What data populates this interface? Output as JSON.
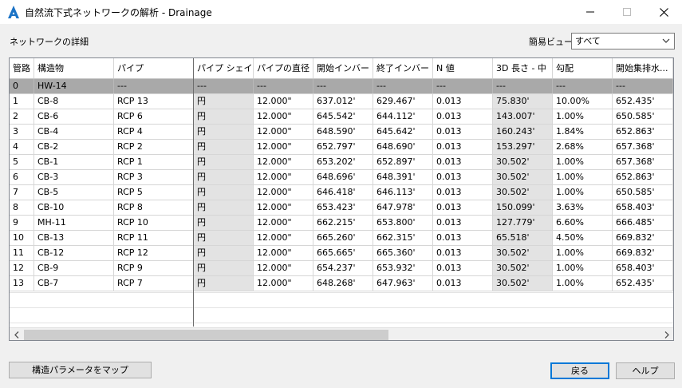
{
  "window": {
    "title": "自然流下式ネットワークの解析 - Drainage",
    "icon": "autodesk-a-icon",
    "controls": [
      "minimize-icon",
      "maximize-icon",
      "close-icon"
    ]
  },
  "header": {
    "network_label": "ネットワークの詳細",
    "view_label": "簡易ビュー",
    "view_value": "すべて"
  },
  "table": {
    "columns": [
      "管路",
      "構造物",
      "パイプ",
      "パイプ シェイプ",
      "パイプの直径",
      "開始インバー",
      "終了インバー",
      "N 値",
      "3D 長さ - 中",
      "勾配",
      "開始集排水..."
    ],
    "rows": [
      [
        "0",
        "HW-14",
        "---",
        "---",
        "---",
        "---",
        "---",
        "---",
        "---",
        "---",
        "---"
      ],
      [
        "1",
        "CB-8",
        "RCP 13",
        "円",
        "12.000\"",
        "637.012'",
        "629.467'",
        "0.013",
        "75.830'",
        "10.00%",
        "652.435'"
      ],
      [
        "2",
        "CB-6",
        "RCP 6",
        "円",
        "12.000\"",
        "645.542'",
        "644.112'",
        "0.013",
        "143.007'",
        "1.00%",
        "650.585'"
      ],
      [
        "3",
        "CB-4",
        "RCP 4",
        "円",
        "12.000\"",
        "648.590'",
        "645.642'",
        "0.013",
        "160.243'",
        "1.84%",
        "652.863'"
      ],
      [
        "4",
        "CB-2",
        "RCP 2",
        "円",
        "12.000\"",
        "652.797'",
        "648.690'",
        "0.013",
        "153.297'",
        "2.68%",
        "657.368'"
      ],
      [
        "5",
        "CB-1",
        "RCP 1",
        "円",
        "12.000\"",
        "653.202'",
        "652.897'",
        "0.013",
        "30.502'",
        "1.00%",
        "657.368'"
      ],
      [
        "6",
        "CB-3",
        "RCP 3",
        "円",
        "12.000\"",
        "648.696'",
        "648.391'",
        "0.013",
        "30.502'",
        "1.00%",
        "652.863'"
      ],
      [
        "7",
        "CB-5",
        "RCP 5",
        "円",
        "12.000\"",
        "646.418'",
        "646.113'",
        "0.013",
        "30.502'",
        "1.00%",
        "650.585'"
      ],
      [
        "8",
        "CB-10",
        "RCP 8",
        "円",
        "12.000\"",
        "653.423'",
        "647.978'",
        "0.013",
        "150.099'",
        "3.63%",
        "658.403'"
      ],
      [
        "9",
        "MH-11",
        "RCP 10",
        "円",
        "12.000\"",
        "662.215'",
        "653.800'",
        "0.013",
        "127.779'",
        "6.60%",
        "666.485'"
      ],
      [
        "10",
        "CB-13",
        "RCP 11",
        "円",
        "12.000\"",
        "665.260'",
        "662.315'",
        "0.013",
        "65.518'",
        "4.50%",
        "669.832'"
      ],
      [
        "11",
        "CB-12",
        "RCP 12",
        "円",
        "12.000\"",
        "665.665'",
        "665.360'",
        "0.013",
        "30.502'",
        "1.00%",
        "669.832'"
      ],
      [
        "12",
        "CB-9",
        "RCP 9",
        "円",
        "12.000\"",
        "654.237'",
        "653.932'",
        "0.013",
        "30.502'",
        "1.00%",
        "658.403'"
      ],
      [
        "13",
        "CB-7",
        "RCP 7",
        "円",
        "12.000\"",
        "648.268'",
        "647.963'",
        "0.013",
        "30.502'",
        "1.00%",
        "652.435'"
      ]
    ],
    "selected_row": 0
  },
  "buttons": {
    "map_params": "構造パラメータをマップ",
    "back": "戻る",
    "help": "ヘルプ"
  },
  "colors": {
    "selected_row": "#a9a9a9",
    "shaded_column": "#e3e3e3",
    "default_button_border": "#0078d7",
    "icon_blue": "#1b73c6"
  }
}
